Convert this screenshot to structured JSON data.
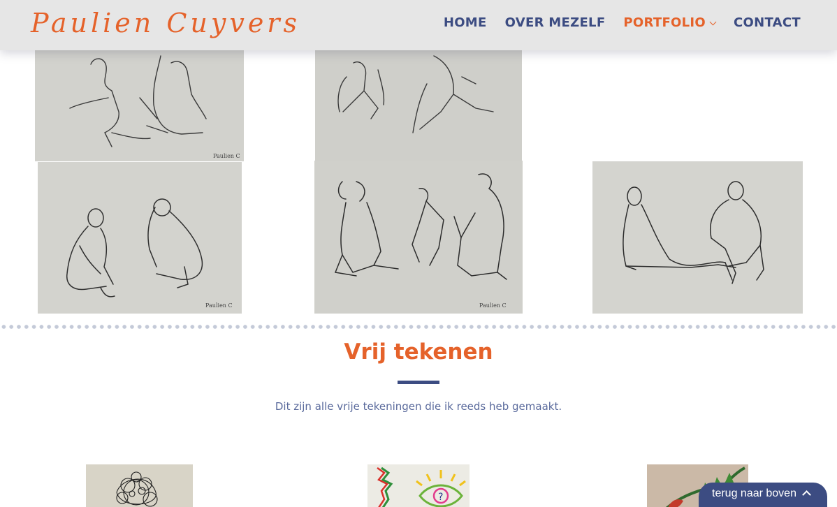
{
  "site": {
    "logo_text": "Paulien Cuyvers",
    "nav": [
      {
        "label": "Home",
        "active": false
      },
      {
        "label": "Over mezelf",
        "active": false
      },
      {
        "label": "Portfolio",
        "active": true,
        "has_dropdown": true
      },
      {
        "label": "Contact",
        "active": false
      }
    ]
  },
  "section": {
    "title": "Vrij tekenen",
    "subtitle": "Dit zijn alle vrije tekeningen die ik reeds heb gemaakt."
  },
  "back_to_top": {
    "label": "terug naar boven",
    "icon": "chevron-up-icon"
  },
  "colors": {
    "accent": "#e5622a",
    "navy": "#3c4c82",
    "header_bg": "#e6e6e6",
    "sketch_paper": "#d4d4cf"
  },
  "gallery": {
    "figure_drawings": [
      "sketch-pair-kneeling",
      "sketch-pair-seated",
      "sketch-pair-crouching",
      "sketch-trio",
      "sketch-pair-reclining"
    ],
    "free_drawings": [
      "ink-doodle",
      "eye-drawing",
      "leaf-drawing"
    ]
  }
}
